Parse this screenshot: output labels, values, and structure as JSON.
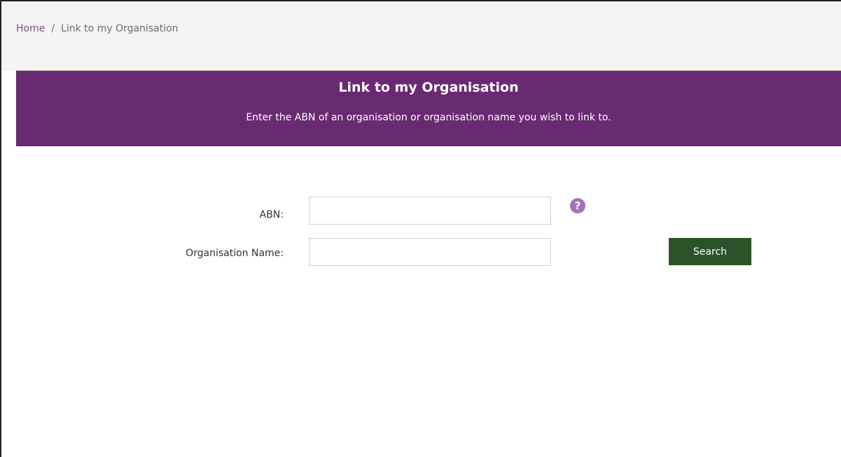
{
  "breadcrumb": {
    "home": "Home",
    "separator": "/",
    "current": "Link to my Organisation"
  },
  "banner": {
    "title": "Link to my Organisation",
    "subtitle": "Enter the ABN of an organisation or organisation name you wish to link to."
  },
  "form": {
    "abn_label": "ABN:",
    "abn_value": "",
    "org_label": "Organisation Name:",
    "org_value": "",
    "help_glyph": "?",
    "help_icon": "question-mark-icon",
    "search_label": "Search"
  },
  "colors": {
    "banner": "#6a2973",
    "help_icon": "#a574b7",
    "search_button": "#2b5329",
    "breadcrumb_link": "#7d4c8c"
  }
}
